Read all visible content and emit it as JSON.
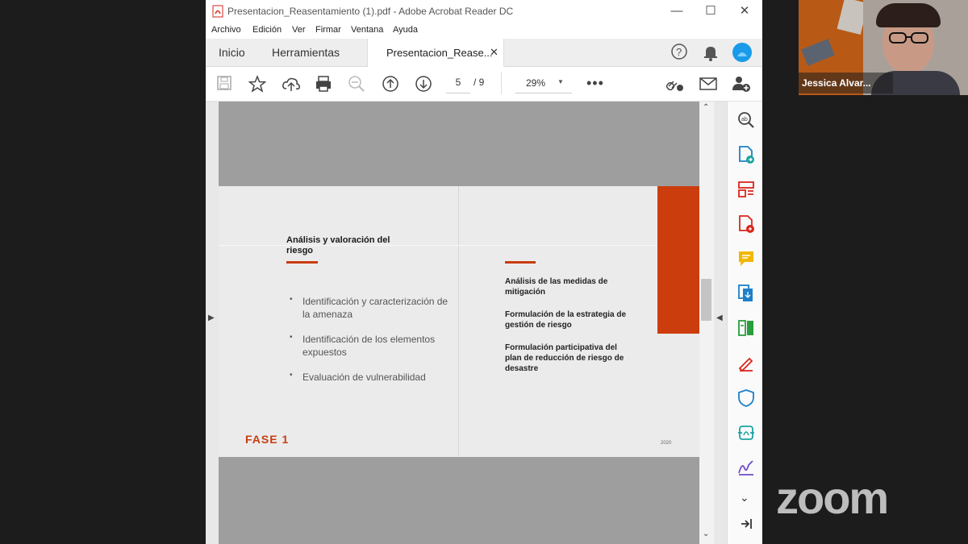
{
  "window": {
    "title": "Presentacion_Reasentamiento (1).pdf - Adobe Acrobat Reader DC"
  },
  "menu": [
    "Archivo",
    "Edición",
    "Ver",
    "Firmar",
    "Ventana",
    "Ayuda"
  ],
  "tabs": {
    "home": "Inicio",
    "tools": "Herramientas",
    "document": "Presentacion_Rease..."
  },
  "toolbar": {
    "page_current": "5",
    "page_total": "/  9",
    "zoom": "29%"
  },
  "slide": {
    "heading": "Análisis y valoración del riesgo",
    "bullets": [
      "Identificación y caracterización de la amenaza",
      "Identificación de los elementos expuestos",
      "Evaluación de vulnerabilidad"
    ],
    "right_items": [
      "Análisis de las medidas de mitigación",
      "Formulación de la estrategia de gestión de riesgo",
      "Formulación participativa del plan de reducción de riesgo de desastre"
    ],
    "phase": "FASE 1",
    "year": "2020"
  },
  "participant": {
    "name": "Jessica Alvar..."
  },
  "zoom_logo": "zoom",
  "colors": {
    "accent_orange": "#cc3d0e",
    "acrobat_red": "#d9271c"
  }
}
